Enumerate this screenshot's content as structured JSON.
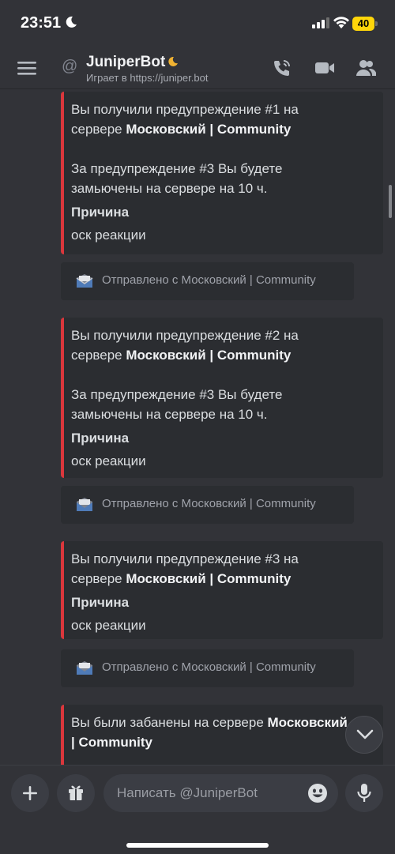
{
  "status_bar": {
    "time": "23:51",
    "battery": "40"
  },
  "header": {
    "bot_name": "JuniperBot",
    "subtitle": "Играет в https://juniper.bot"
  },
  "messages": [
    {
      "line1_prefix": "Вы получили предупреждение #1 на",
      "line2_prefix": "сервере ",
      "server": "Московский | Community",
      "note_line1": "За предупреждение #3 Вы будете",
      "note_line2": "замьючены на сервере на 10 ч.",
      "field_name": "Причина",
      "field_value": "оск реакции",
      "sent_from": "Отправлено с Московский | Community"
    },
    {
      "line1_prefix": "Вы получили предупреждение #2 на",
      "line2_prefix": "сервере ",
      "server": "Московский | Community",
      "note_line1": "За предупреждение #3 Вы будете",
      "note_line2": "замьючены на сервере на 10 ч.",
      "field_name": "Причина",
      "field_value": "оск реакции",
      "sent_from": "Отправлено с Московский | Community"
    },
    {
      "line1_prefix": "Вы получили предупреждение #3 на",
      "line2_prefix": "сервере ",
      "server": "Московский | Community",
      "field_name": "Причина",
      "field_value": "оск реакции",
      "sent_from": "Отправлено с Московский | Community"
    },
    {
      "line1_prefix": "Вы были забанены на сервере ",
      "server_part1": "Московский",
      "server_part2": "| Community"
    }
  ],
  "composer": {
    "placeholder": "Написать @JuniperBot"
  },
  "colors": {
    "background": "#323338",
    "embed_bg": "#2b2d31",
    "embed_accent": "#da373c",
    "battery": "#ffd60a",
    "idle_status": "#f0b232"
  },
  "icons": {
    "menu": "hamburger-icon",
    "at": "at-icon",
    "call": "phone-call-icon",
    "video": "video-camera-icon",
    "members": "members-icon",
    "sent": "envelope-icon",
    "scroll": "chevron-down-icon",
    "plus": "plus-icon",
    "gift": "gift-icon",
    "emoji": "emoji-icon",
    "mic": "microphone-icon"
  }
}
